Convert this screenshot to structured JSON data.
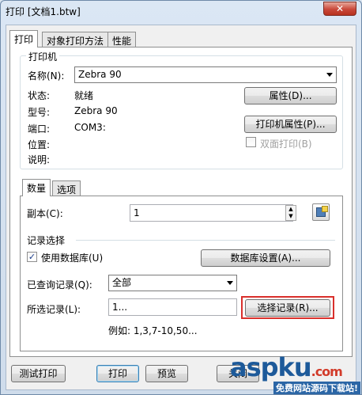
{
  "window": {
    "title": "打印 [文档1.btw]",
    "close": "✕"
  },
  "tabs": [
    "打印",
    "对象打印方法",
    "性能"
  ],
  "printer": {
    "group_label": "打印机",
    "name_label": "名称(N):",
    "name_value": "Zebra 90",
    "status_label": "状态:",
    "status_value": "就绪",
    "model_label": "型号:",
    "model_value": "Zebra 90",
    "port_label": "端口:",
    "port_value": "COM3:",
    "location_label": "位置:",
    "comment_label": "说明:",
    "properties_button": "属性(D)...",
    "printer_properties_button": "打印机属性(P)...",
    "duplex_label": "双面打印(B)"
  },
  "inner_tabs": [
    "数量",
    "选项"
  ],
  "quantity": {
    "copies_label": "副本(C):",
    "copies_value": "1",
    "record_section_label": "记录选择",
    "use_database_label": "使用数据库(U)",
    "database_settings_button": "数据库设置(A)...",
    "queried_records_label": "已查询记录(Q):",
    "queried_records_value": "全部",
    "selected_records_label": "所选记录(L):",
    "selected_records_value": "1...",
    "select_records_button": "选择记录(R)...",
    "example_text": "例如: 1,3,7-10,50..."
  },
  "footer": {
    "test_print": "测试打印",
    "print": "打印",
    "preview": "预览",
    "close": "关闭"
  },
  "watermark": {
    "brand": "aspku",
    "suffix": ".com",
    "tagline": "免费网站源码下载站!"
  }
}
